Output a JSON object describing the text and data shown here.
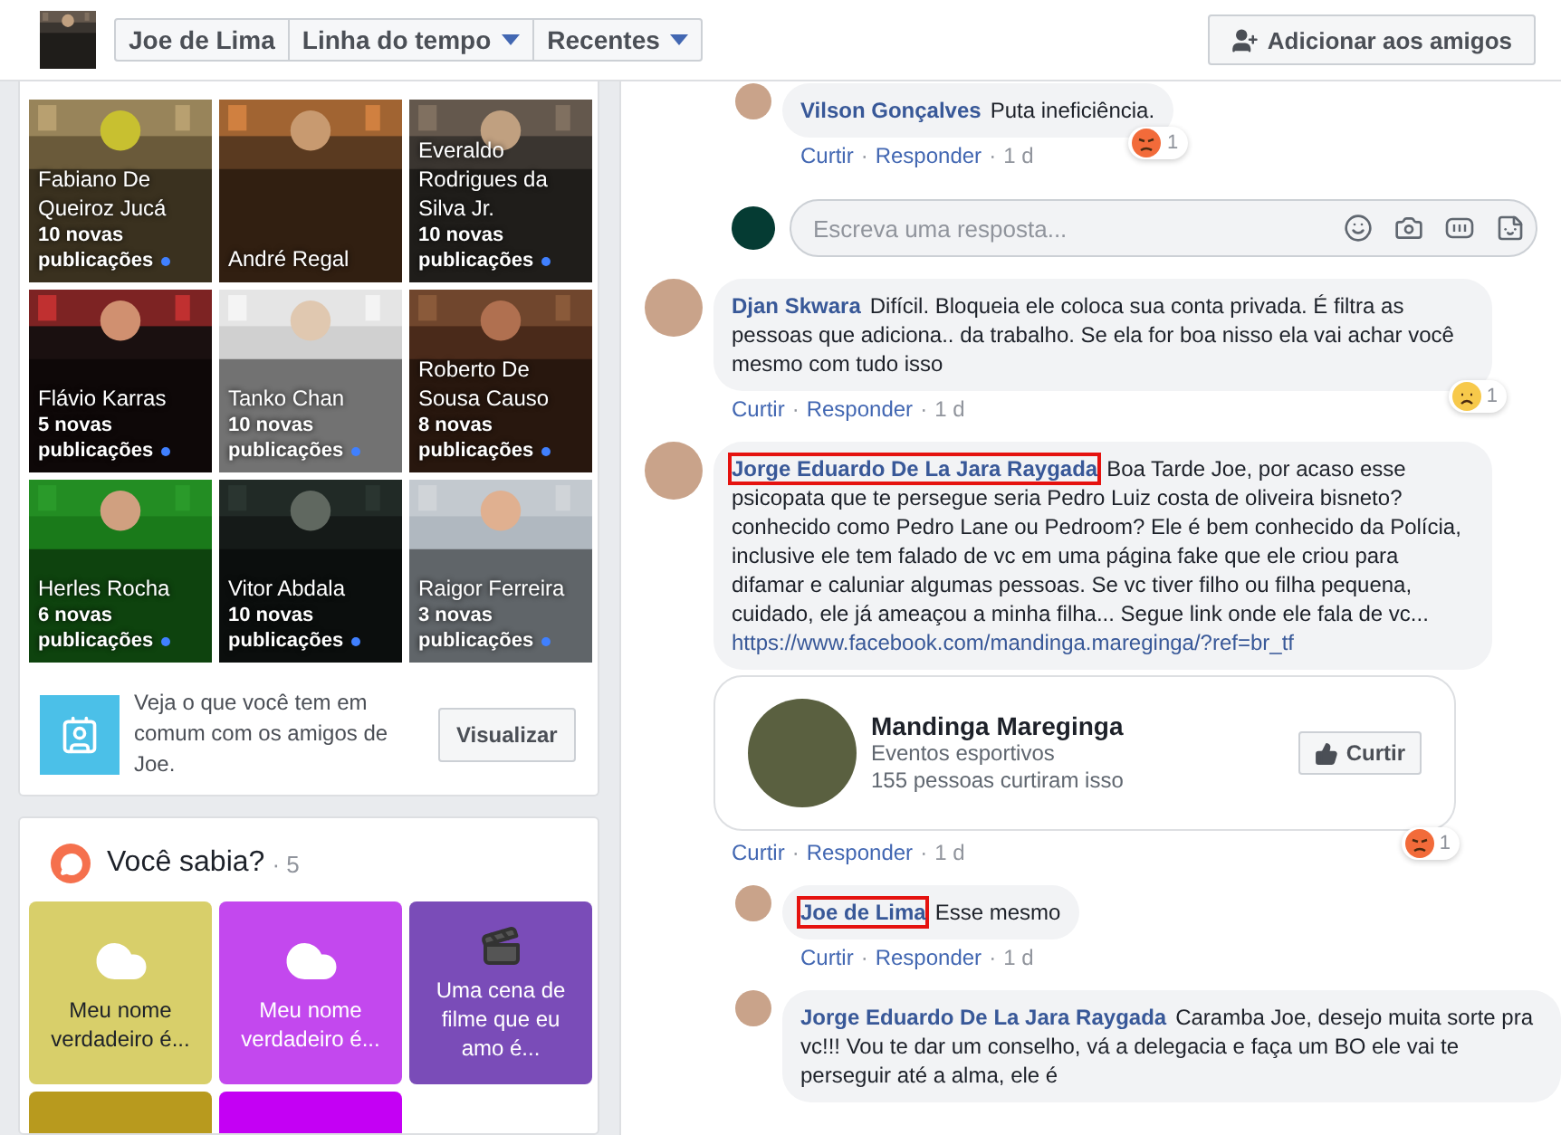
{
  "nav_tabs": [
    {
      "label": "Joe de Lima",
      "dropdown": false
    },
    {
      "label": "Linha do tempo",
      "dropdown": true
    },
    {
      "label": "Recentes",
      "dropdown": true
    }
  ],
  "add_friend_button": "Adicionar aos amigos",
  "friends": [
    {
      "name": "Fabiano De Queiroz Jucá",
      "count": "10 novas",
      "updates": "publicações"
    },
    {
      "name": "André Regal"
    },
    {
      "name": "Everaldo Rodrigues da Silva Jr.",
      "count": "10 novas",
      "updates": "publicações"
    },
    {
      "name": "Flávio Karras",
      "count": "5 novas",
      "updates": "publicações"
    },
    {
      "name": "Tanko Chan",
      "count": "10 novas",
      "updates": "publicações"
    },
    {
      "name": "Roberto De Sousa Causo",
      "count": "8 novas",
      "updates": "publicações"
    },
    {
      "name": "Herles Rocha",
      "count": "6 novas",
      "updates": "publicações"
    },
    {
      "name": "Vitor Abdala",
      "count": "10 novas",
      "updates": "publicações"
    },
    {
      "name": "Raigor Ferreira",
      "count": "3 novas",
      "updates": "publicações"
    }
  ],
  "common_friends": {
    "text": "Veja o que você tem em comum com os amigos de Joe.",
    "button": "Visualizar"
  },
  "did_you_know": {
    "title": "Você sabia?",
    "count": "· 5",
    "cards": [
      {
        "kind": "thought",
        "color": "#d8cf6a",
        "text": "Meu nome verdadeiro é..."
      },
      {
        "kind": "thought",
        "color": "#c348ee",
        "text": "Meu nome verdadeiro é..."
      },
      {
        "kind": "clapper",
        "color": "#7a4cb8",
        "text": "Uma cena de filme que eu amo é..."
      },
      {
        "kind": "blank",
        "color": "#b89a1e"
      },
      {
        "kind": "blank",
        "color": "#c400f4"
      }
    ]
  },
  "separator": "·",
  "earlier_replies": [
    {
      "author": "Vilson Gonçalves",
      "text": "Puta ineficiência.",
      "highlighted": false,
      "reaction": {
        "kind": "angry",
        "count": "1"
      },
      "actions": [
        "Curtir",
        "Responder",
        "1 d"
      ]
    }
  ],
  "reply_box": {
    "placeholder": "Escreva uma resposta..."
  },
  "comments": [
    {
      "author": "Djan Skwara",
      "text": "Difícil. Bloqueia ele coloca sua conta privada. É filtra as pessoas que adiciona.. da trabalho. Se ela for boa nisso ela vai achar você mesmo com tudo isso",
      "highlighted": false,
      "reaction": {
        "kind": "sad",
        "count": "1"
      },
      "actions": [
        "Curtir",
        "Responder",
        "1 d"
      ]
    },
    {
      "author": "Jorge Eduardo De La Jara Raygada",
      "text": "Boa Tarde Joe, por acaso esse psicopata que te persegue seria Pedro Luiz costa de oliveira bisneto? conhecido como Pedro Lane ou Pedroom? Ele é bem conhecido da Polícia, inclusive ele tem falado de vc em uma página fake que ele criou para difamar e caluniar algumas pessoas. Se vc tiver filho ou filha pequena, cuidado, ele já ameaçou a minha filha... Segue link onde ele fala de vc...",
      "link": "https://www.facebook.com/mandinga.mareginga/?ref=br_tf",
      "highlighted": true,
      "preview": {
        "title": "Mandinga Mareginga",
        "category": "Eventos esportivos",
        "likes": "155 pessoas curtiram isso",
        "button": "Curtir"
      },
      "reaction": {
        "kind": "angry",
        "count": "1"
      },
      "actions": [
        "Curtir",
        "Responder",
        "1 d"
      ],
      "children": [
        {
          "author": "Joe de Lima",
          "text": "Esse mesmo",
          "highlighted": true,
          "actions": [
            "Curtir",
            "Responder",
            "1 d"
          ]
        },
        {
          "author": "Jorge Eduardo De La Jara Raygada",
          "text": "Caramba Joe, desejo muita sorte pra vc!!! Vou te dar um conselho, vá a delegacia e faça um BO ele vai te perseguir até a alma, ele é",
          "highlighted": false
        }
      ]
    }
  ]
}
